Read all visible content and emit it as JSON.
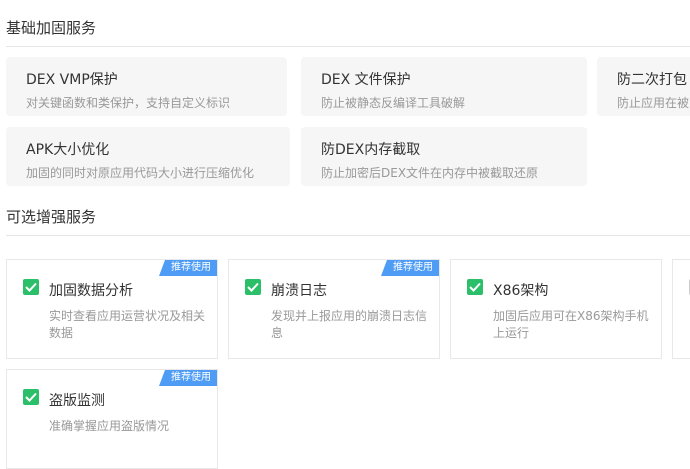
{
  "sections": {
    "basic_title": "基础加固服务",
    "optional_title": "可选增强服务"
  },
  "basic_services": [
    {
      "title": "DEX VMP保护",
      "desc": "对关键函数和类保护，支持自定义标识"
    },
    {
      "title": "DEX 文件保护",
      "desc": "防止被静态反编译工具破解"
    },
    {
      "title": "防二次打包",
      "desc": "防止应用在被"
    },
    {
      "title": "APK大小优化",
      "desc": "加固的同时对原应用代码大小进行压缩优化"
    },
    {
      "title": "防DEX内存截取",
      "desc": "防止加密后DEX文件在内存中被截取还原"
    }
  ],
  "optional_services": [
    {
      "title": "加固数据分析",
      "desc": "实时查看应用运营状况及相关数据",
      "badge": "推荐使用",
      "checked": true
    },
    {
      "title": "崩溃日志",
      "desc": "发现并上报应用的崩溃日志信息",
      "badge": "推荐使用",
      "checked": true
    },
    {
      "title": "X86架构",
      "desc": "加固后应用可在X86架构手机上运行",
      "badge": "",
      "checked": true
    },
    {
      "title": "盗版监测",
      "desc": "准确掌握应用盗版情况",
      "badge": "推荐使用",
      "checked": true
    }
  ],
  "colors": {
    "checkbox": "#2bbf6a",
    "badge": "#4e9cf5",
    "card_bg": "#f6f6f6"
  }
}
